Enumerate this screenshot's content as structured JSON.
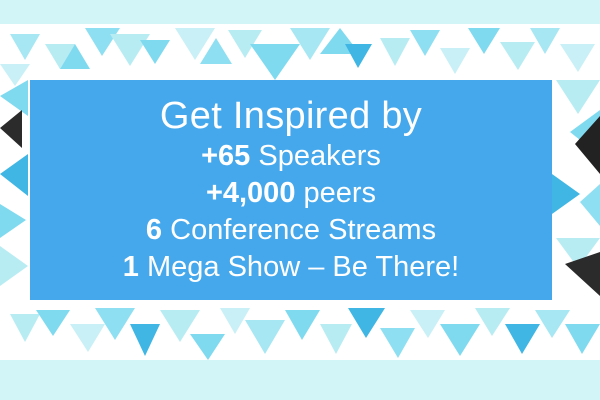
{
  "headline": "Get Inspired by",
  "lines": [
    {
      "bold": "+65",
      "rest": " Speakers"
    },
    {
      "bold": "+4,000",
      "rest": " peers"
    },
    {
      "bold": "6",
      "rest": " Conference Streams"
    },
    {
      "bold": "1",
      "rest": " Mega Show – Be There!"
    }
  ],
  "colors": {
    "frame": "#d2f6f7",
    "card": "#45a8ec",
    "text": "#ffffff",
    "triangle_light": "#b8ecf3",
    "triangle_mid": "#7fdaf0",
    "triangle_deep": "#3fb6e4"
  }
}
